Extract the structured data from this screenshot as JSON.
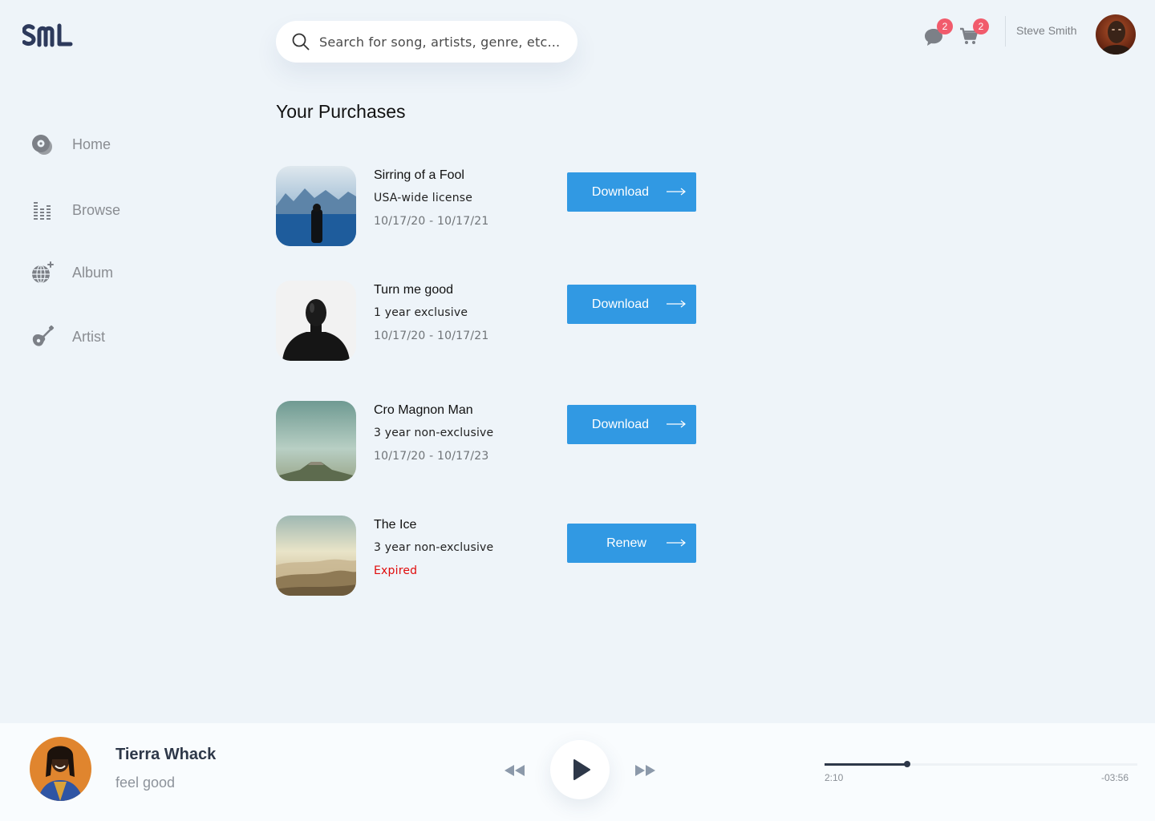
{
  "brand": {
    "logo_text": "SML",
    "logo_color": "#2d3a5c"
  },
  "search": {
    "placeholder": "Search for song, artists, genre, etc..."
  },
  "header": {
    "messages_badge": "2",
    "cart_badge": "2",
    "user_name": "Steve Smith"
  },
  "sidebar": {
    "items": [
      {
        "label": "Home",
        "icon": "vinyl-disc-icon"
      },
      {
        "label": "Browse",
        "icon": "equalizer-icon"
      },
      {
        "label": "Album",
        "icon": "disco-ball-icon"
      },
      {
        "label": "Artist",
        "icon": "guitar-icon"
      }
    ]
  },
  "main": {
    "title": "Your Purchases",
    "purchases": [
      {
        "title": "Sirring of a Fool",
        "license": "USA-wide license",
        "dates": "10/17/20 - 10/17/21",
        "action": "Download"
      },
      {
        "title": "Turn me good",
        "license": "1 year exclusive",
        "dates": "10/17/20 - 10/17/21",
        "action": "Download"
      },
      {
        "title": "Cro Magnon Man",
        "license": "3 year non-exclusive",
        "dates": "10/17/20 - 10/17/23",
        "action": "Download"
      },
      {
        "title": "The Ice",
        "license": "3 year non-exclusive",
        "dates": "Expired",
        "action": "Renew"
      }
    ]
  },
  "player": {
    "artist": "Tierra Whack",
    "track": "feel good",
    "current_time": "2:10",
    "remaining_time": "-03:56",
    "progress_fraction": 0.265
  },
  "colors": {
    "accent": "#3199e3",
    "badge": "#f15b6c",
    "expired": "#e00b0b",
    "background": "#eef4f9"
  }
}
